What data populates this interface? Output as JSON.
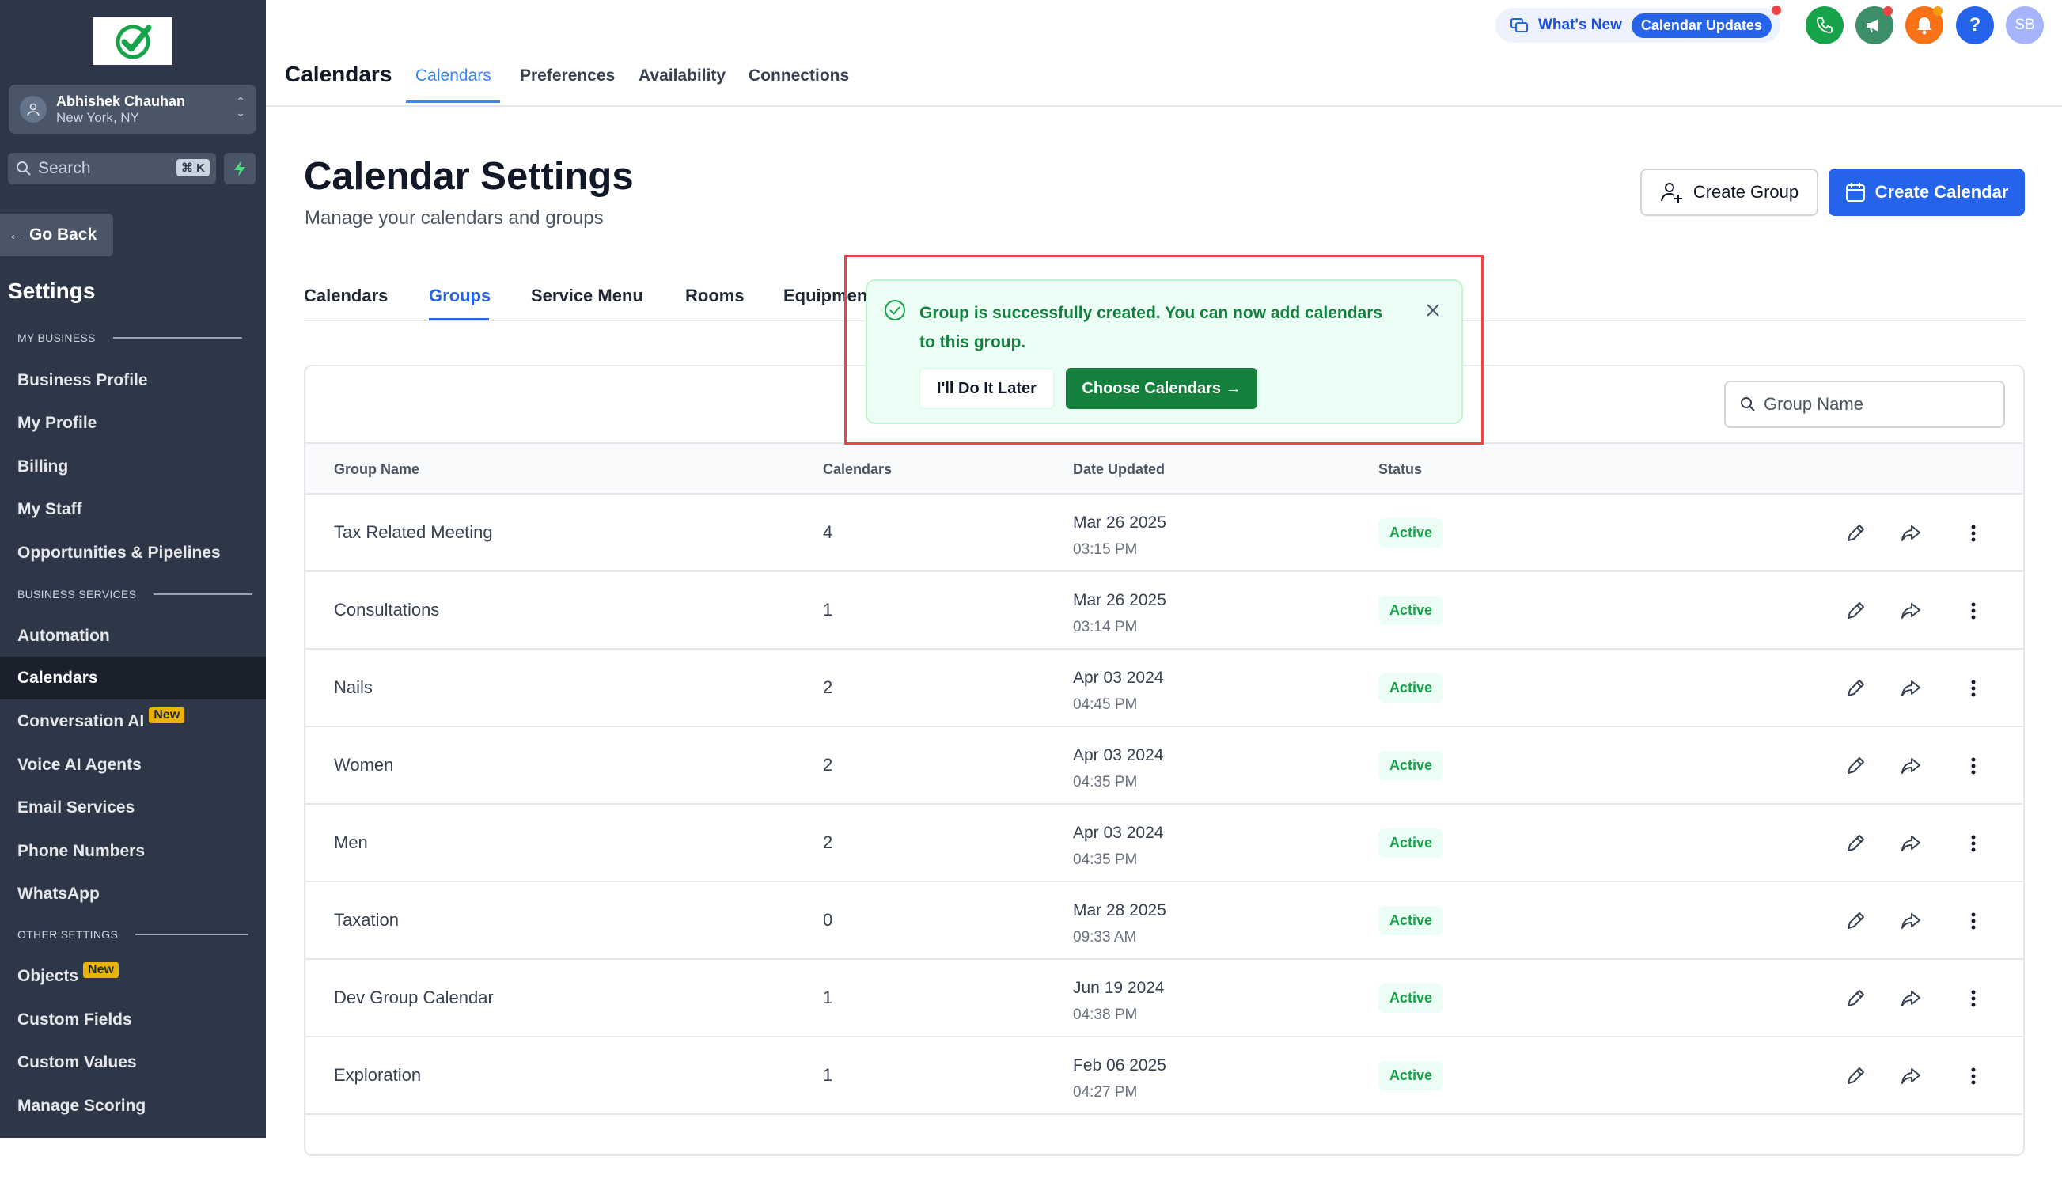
{
  "sidebar": {
    "account": {
      "name": "Abhishek Chauhan",
      "location": "New York, NY"
    },
    "search": {
      "placeholder": "Search",
      "shortcut": "⌘ K"
    },
    "go_back": "Go Back",
    "title": "Settings",
    "sections": [
      {
        "label": "MY BUSINESS",
        "items": [
          "Business Profile",
          "My Profile",
          "Billing",
          "My Staff",
          "Opportunities & Pipelines"
        ]
      },
      {
        "label": "BUSINESS SERVICES",
        "items": [
          "Automation",
          "Calendars",
          "Conversation AI",
          "Voice AI Agents",
          "Email Services",
          "Phone Numbers",
          "WhatsApp"
        ]
      },
      {
        "label": "OTHER SETTINGS",
        "items": [
          "Objects",
          "Custom Fields",
          "Custom Values",
          "Manage Scoring"
        ]
      }
    ],
    "active_item": "Calendars",
    "new_badge": "New"
  },
  "topbar": {
    "title": "Calendars",
    "tabs": [
      "Calendars",
      "Preferences",
      "Availability",
      "Connections"
    ],
    "active_tab": "Calendars",
    "whats_new": "What's New",
    "calendar_updates": "Calendar Updates",
    "user_initials": "SB",
    "help": "?"
  },
  "page": {
    "title": "Calendar Settings",
    "subtitle": "Manage your calendars and groups",
    "create_group": "Create Group",
    "create_calendar": "Create Calendar",
    "subtabs": [
      "Calendars",
      "Groups",
      "Service Menu",
      "Rooms",
      "Equipment"
    ],
    "active_subtab": "Groups",
    "group_search_placeholder": "Group Name"
  },
  "table": {
    "headers": [
      "Group Name",
      "Calendars",
      "Date Updated",
      "Status"
    ],
    "rows": [
      {
        "name": "Tax Related Meeting",
        "calendars": "4",
        "date": "Mar 26 2025",
        "time": "03:15 PM",
        "status": "Active"
      },
      {
        "name": "Consultations",
        "calendars": "1",
        "date": "Mar 26 2025",
        "time": "03:14 PM",
        "status": "Active"
      },
      {
        "name": "Nails",
        "calendars": "2",
        "date": "Apr 03 2024",
        "time": "04:45 PM",
        "status": "Active"
      },
      {
        "name": "Women",
        "calendars": "2",
        "date": "Apr 03 2024",
        "time": "04:35 PM",
        "status": "Active"
      },
      {
        "name": "Men",
        "calendars": "2",
        "date": "Apr 03 2024",
        "time": "04:35 PM",
        "status": "Active"
      },
      {
        "name": "Taxation",
        "calendars": "0",
        "date": "Mar 28 2025",
        "time": "09:33 AM",
        "status": "Active"
      },
      {
        "name": "Dev Group Calendar",
        "calendars": "1",
        "date": "Jun 19 2024",
        "time": "04:38 PM",
        "status": "Active"
      },
      {
        "name": "Exploration",
        "calendars": "1",
        "date": "Feb 06 2025",
        "time": "04:27 PM",
        "status": "Active"
      }
    ]
  },
  "toast": {
    "message": "Group is successfully created. You can now add calendars to this group.",
    "later": "I'll Do It Later",
    "choose": "Choose Calendars →"
  },
  "colors": {
    "sidebar": "#2d3748",
    "primary": "#2563eb",
    "success": "#15803d",
    "highlight": "#ef4444"
  }
}
